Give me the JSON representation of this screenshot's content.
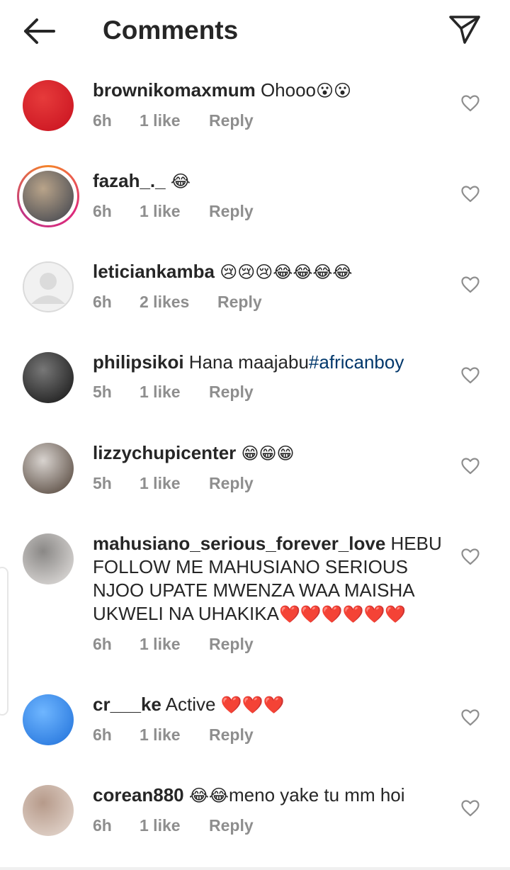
{
  "header": {
    "title": "Comments",
    "back_icon": "arrow-left-icon",
    "share_icon": "paper-plane-icon"
  },
  "comments": [
    {
      "username": "brownikomaxmum",
      "text": " Ohooo",
      "emoji": "😮😮",
      "time": "6h",
      "likes": "1 like",
      "reply": "Reply",
      "avatar_colors": [
        "#c8101e",
        "#e63b3b"
      ],
      "ring": false
    },
    {
      "username": "fazah_._",
      "text": " ",
      "emoji": "😂",
      "time": "6h",
      "likes": "1 like",
      "reply": "Reply",
      "avatar_colors": [
        "#3a3f4a",
        "#b9a48a"
      ],
      "ring": true
    },
    {
      "username": "leticiankamba",
      "text": " ",
      "emoji": "😢😢😢😂😂😂😂",
      "time": "6h",
      "likes": "2 likes",
      "reply": "Reply",
      "avatar_colors": [
        "#dbdbdb",
        "#f2f2f2"
      ],
      "ring": false,
      "default_avatar": true
    },
    {
      "username": "philipsikoi",
      "text": " Hana maajabu",
      "hashtag": "#africanboy",
      "time": "5h",
      "likes": "1 like",
      "reply": "Reply",
      "avatar_colors": [
        "#111111",
        "#777777"
      ],
      "ring": false
    },
    {
      "username": "lizzychupicenter",
      "text": " ",
      "emoji": "😁😁😁",
      "time": "5h",
      "likes": "1 like",
      "reply": "Reply",
      "avatar_colors": [
        "#4a3b30",
        "#d8d3cf"
      ],
      "ring": false
    },
    {
      "username": "mahusiano_serious_forever_love",
      "text": " HEBU FOLLOW ME MAHUSIANO SERIOUS NJOO UPATE MWENZA WAA MAISHA UKWELI NA UHAKIKA",
      "emoji": "❤️❤️❤️❤️❤️❤️",
      "time": "6h",
      "likes": "1 like",
      "reply": "Reply",
      "avatar_colors": [
        "#e7e4e2",
        "#8a8886"
      ],
      "ring": false
    },
    {
      "username": "cr___ke",
      "text": " Active ",
      "emoji": "❤️❤️❤️",
      "time": "6h",
      "likes": "1 like",
      "reply": "Reply",
      "avatar_colors": [
        "#1e6fd9",
        "#6fb6ff"
      ],
      "ring": false
    },
    {
      "username": "corean880",
      "text": " ",
      "emoji": "😂😂",
      "text_after": "meno yake tu mm hoi",
      "time": "6h",
      "likes": "1 like",
      "reply": "Reply",
      "avatar_colors": [
        "#e8dcd4",
        "#b69a8a"
      ],
      "ring": false
    }
  ],
  "colors": {
    "text": "#262626",
    "meta": "#8e8e8e",
    "hashtag": "#00376b",
    "heart_outline": "#8e8e8e"
  },
  "heart_icon": "heart-outline-icon"
}
